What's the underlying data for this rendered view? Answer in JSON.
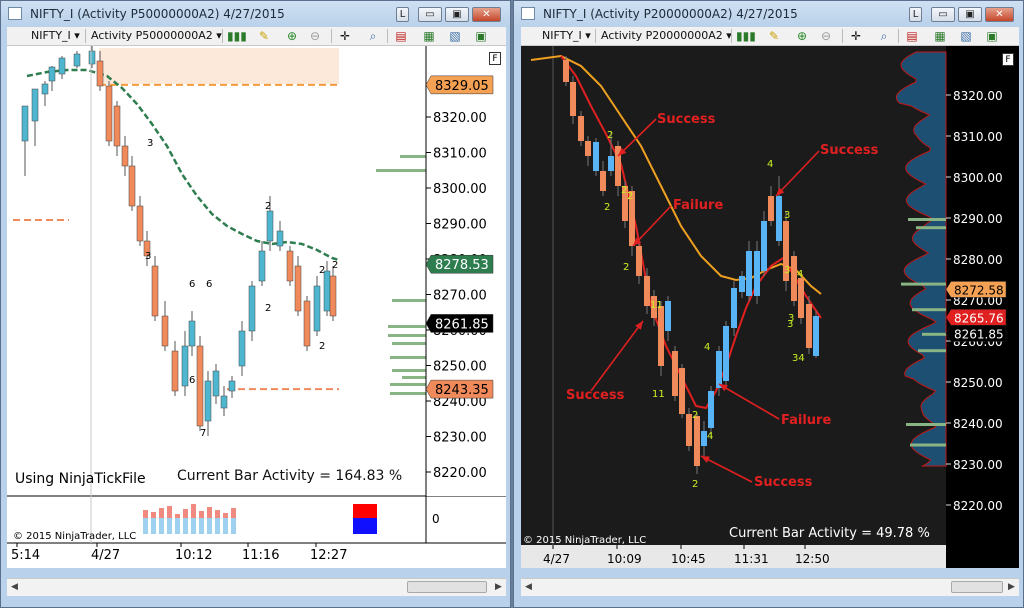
{
  "left_window": {
    "title": "NIFTY_I (Activity P50000000A2)  4/27/2015",
    "controls": {
      "l": "L",
      "min": "▭",
      "max": "▣",
      "close": "✕"
    },
    "toolbar": {
      "instrument": "NIFTY_I",
      "indicator": "Activity P50000000A2",
      "dropdown": "▾"
    },
    "f_button": "F",
    "footer_left": "Using NinjaTickFile",
    "current_activity": "Current Bar Activity = 164.83 %",
    "copyright": "© 2015 NinjaTrader, LLC",
    "sub_axis_label": "0",
    "price_ticks": [
      "8320.00",
      "8310.00",
      "8300.00",
      "8290.00",
      "8280.00",
      "8270.00",
      "8260.00",
      "8250.00",
      "8240.00",
      "8230.00",
      "8220.00"
    ],
    "time_ticks": [
      "5:14",
      "4/27",
      "10:12",
      "11:16",
      "12:27"
    ],
    "price_badges": [
      {
        "text": "8329.05",
        "bg": "#f5a154",
        "fg": "#000000"
      },
      {
        "text": "8278.53",
        "bg": "#2e7d4f",
        "fg": "#ffffff"
      },
      {
        "text": "8261.85",
        "bg": "#000000",
        "fg": "#ffffff"
      },
      {
        "text": "8243.35",
        "bg": "#f08a5a",
        "fg": "#000000"
      }
    ],
    "activity_labels": [
      "3",
      "3",
      "6",
      "6",
      "6",
      "7",
      "2",
      "2",
      "2",
      "2",
      "2"
    ],
    "colors": {
      "up": "#4fb6d0",
      "down": "#f08a5a",
      "ma": "#2e7d4f",
      "level": "#f39c3c",
      "profile": "#88b583",
      "bg": "#ffffff"
    }
  },
  "right_window": {
    "title": "NIFTY_I (Activity P20000000A2)  4/27/2015",
    "controls": {
      "l": "L",
      "min": "▭",
      "max": "▣",
      "close": "✕"
    },
    "toolbar": {
      "instrument": "NIFTY_I",
      "indicator": "Activity P20000000A2",
      "dropdown": "▾"
    },
    "f_button": "F",
    "current_activity": "Current Bar Activity = 49.78 %",
    "copyright": "© 2015 NinjaTrader, LLC",
    "price_ticks": [
      "8320.00",
      "8310.00",
      "8300.00",
      "8290.00",
      "8280.00",
      "8270.00",
      "8260.00",
      "8250.00",
      "8240.00",
      "8230.00",
      "8220.00"
    ],
    "time_ticks": [
      "4/27",
      "10:09",
      "10:45",
      "11:31",
      "12:50"
    ],
    "price_badges": [
      {
        "text": "8272.58",
        "bg": "#f5a154",
        "fg": "#000000"
      },
      {
        "text": "8265.76",
        "bg": "#e02020",
        "fg": "#ffffff"
      },
      {
        "text": "8261.85",
        "bg": "#000000",
        "fg": "#ffffff"
      }
    ],
    "annotations": [
      {
        "text": "Success"
      },
      {
        "text": "Failure"
      },
      {
        "text": "Success"
      },
      {
        "text": "Success"
      },
      {
        "text": "Failure"
      },
      {
        "text": "Success"
      }
    ],
    "activity_labels": [
      "2",
      "2",
      "2",
      "2",
      "2",
      "11",
      "11",
      "2",
      "2",
      "4",
      "4",
      "4",
      "3",
      "3",
      "3",
      "4",
      "3",
      "34"
    ],
    "colors": {
      "up": "#58b4f5",
      "down": "#f08a5a",
      "fast_ma": "#e02020",
      "slow_ma": "#f0a020",
      "annot": "#e02020",
      "label": "#c8f020",
      "bg": "#1b1b1b"
    }
  }
}
